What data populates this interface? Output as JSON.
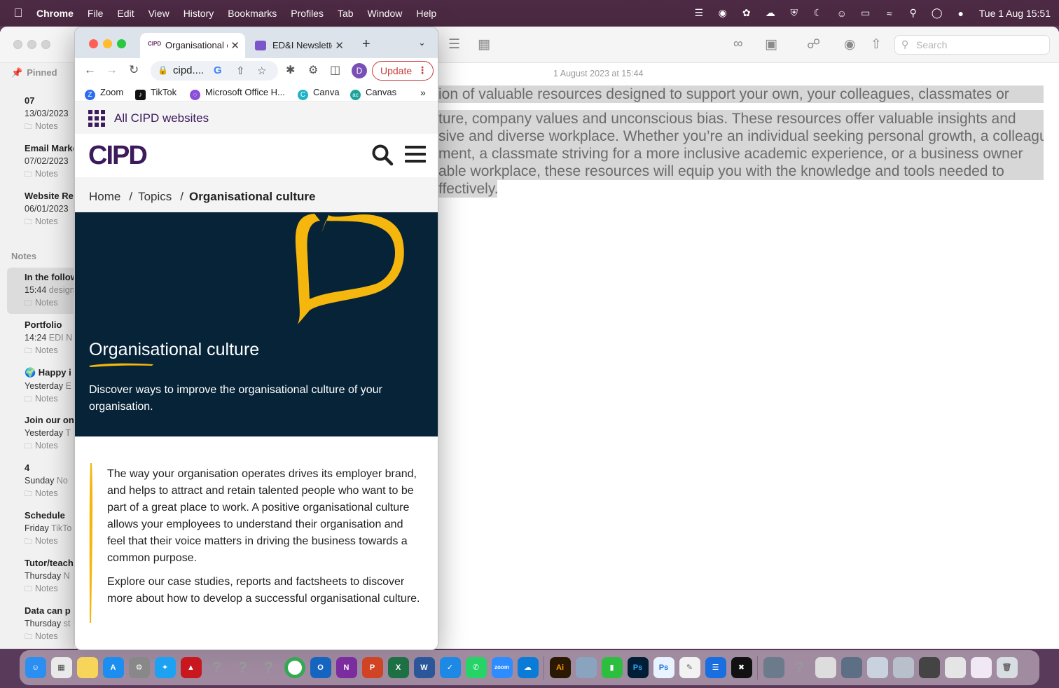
{
  "menubar": {
    "app_name": "Chrome",
    "items": [
      "File",
      "Edit",
      "View",
      "History",
      "Bookmarks",
      "Profiles",
      "Tab",
      "Window",
      "Help"
    ],
    "clock": "Tue 1 Aug  15:51"
  },
  "notes": {
    "search_placeholder": "Search",
    "pinned_header": "Pinned",
    "notes_header": "Notes",
    "pinned": [
      {
        "title": "07",
        "date": "13/03/2023",
        "preview": "",
        "folder": "Notes"
      },
      {
        "title": "Email Marketing",
        "date": "07/02/2023",
        "preview": "",
        "folder": "Notes"
      },
      {
        "title": "Website Re",
        "date": "06/01/2023",
        "preview": "",
        "folder": "Notes"
      }
    ],
    "list": [
      {
        "title": "In the following",
        "date": "15:44",
        "preview": "design",
        "folder": "Notes",
        "selected": true
      },
      {
        "title": "Portfolio",
        "date": "14:24",
        "preview": "EDI N",
        "folder": "Notes"
      },
      {
        "title": "🌍 Happy i",
        "date": "Yesterday",
        "preview": "E",
        "folder": "Notes"
      },
      {
        "title": "Join our on",
        "date": "Yesterday",
        "preview": "T",
        "folder": "Notes"
      },
      {
        "title": "4",
        "date": "Sunday",
        "preview": "No",
        "folder": "Notes"
      },
      {
        "title": "Schedule",
        "date": "Friday",
        "preview": "TikTo",
        "folder": "Notes"
      },
      {
        "title": "Tutor/teach",
        "date": "Thursday",
        "preview": "N",
        "folder": "Notes"
      },
      {
        "title": "Data can p",
        "date": "Thursday",
        "preview": "st",
        "folder": "Notes"
      }
    ],
    "note_date": "1 August 2023 at 15:44",
    "body_lines": [
      "ion of valuable resources designed to support your own, your colleagues, classmates  or",
      "ture, company values and unconscious bias.  These resources offer valuable insights and",
      "sive and diverse workplace. Whether you’re an individual seeking personal growth, a colleague",
      "ment, a classmate striving for a more inclusive academic experience, or a business owner",
      "able workplace, these resources will equip you with the knowledge and tools needed to",
      "ffectively."
    ]
  },
  "chrome": {
    "tabs": [
      {
        "title": "Organisational c",
        "favicon": "CIPD",
        "active": true
      },
      {
        "title": "ED&I Newsletter",
        "active": false
      }
    ],
    "url": "cipd....",
    "update_label": "Update",
    "profile_initial": "D",
    "bookmarks": [
      {
        "label": "Zoom",
        "icon": "Z",
        "color": "#2d6cf0"
      },
      {
        "label": "TikTok",
        "icon": "♪",
        "color": "#111111"
      },
      {
        "label": "Microsoft Office H...",
        "icon": "◌",
        "color": "#8a4fd8"
      },
      {
        "label": "Canva",
        "icon": "C",
        "color": "#20b3c4"
      },
      {
        "label": "Canvas",
        "icon": "ac",
        "color": "#1aa39a"
      }
    ],
    "bookmarks_more": "»"
  },
  "page": {
    "top_bar_label": "All CIPD websites",
    "logo": "CIPD",
    "breadcrumb": {
      "home": "Home",
      "topics": "Topics",
      "current": "Organisational culture"
    },
    "hero_title": "Organisational culture",
    "hero_desc": "Discover ways to improve the organisational culture of your organisation.",
    "intro_p1": "The way your organisation operates drives its employer brand, and helps to attract and retain talented people who want to be part of a great place to work. A positive organisational culture allows your employees to understand their organisation and feel that their voice matters in driving the business towards a common purpose.",
    "intro_p2": "Explore our case studies, reports and factsheets to discover more about how to develop a successful organisational culture."
  },
  "colors": {
    "cipd_purple": "#3c1a5b",
    "hero_navy": "#062338",
    "accent_yellow": "#f5b60e"
  }
}
